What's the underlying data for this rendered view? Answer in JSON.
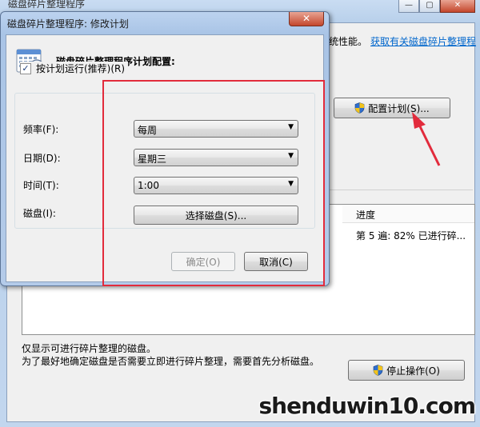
{
  "main_window": {
    "title": "磁盘碎片整理程序",
    "caption_buttons": [
      "—",
      "▢",
      "✕"
    ],
    "description_tail": "统性能。",
    "link_text": "获取有关磁盘碎片整理程",
    "configure_button": "配置计划(S)...",
    "list": {
      "progress_header": "进度",
      "progress_row": "第 5 遍: 82% 已进行碎..."
    },
    "footnote1": "仅显示可进行碎片整理的磁盘。",
    "footnote2": "为了最好地确定磁盘是否需要立即进行碎片整理，需要首先分析磁盘。",
    "stop_button": "停止操作(O)"
  },
  "dialog": {
    "title": "磁盘碎片整理程序: 修改计划",
    "close_glyph": "✕",
    "heading": "磁盘碎片整理程序计划配置:",
    "schedule_checkbox_label": "按计划运行(推荐)(R)",
    "schedule_checked": true,
    "frequency": {
      "label": "频率(F):",
      "value": "每周"
    },
    "day": {
      "label": "日期(D):",
      "value": "星期三"
    },
    "time": {
      "label": "时间(T):",
      "value": "1:00"
    },
    "disk": {
      "label": "磁盘(I):",
      "button": "选择磁盘(S)..."
    },
    "ok_button": "确定(O)",
    "cancel_button": "取消(C)"
  },
  "watermark": "shenduwin10.com",
  "colors": {
    "annotation_red": "#e22b3c",
    "link": "#0066cc",
    "titlebar": "#b7cfea"
  },
  "icons": {
    "dialog_icon": "calendar-clock-icon",
    "button_icon": "uac-shield-icon",
    "dropdown": "chevron-down-icon"
  }
}
